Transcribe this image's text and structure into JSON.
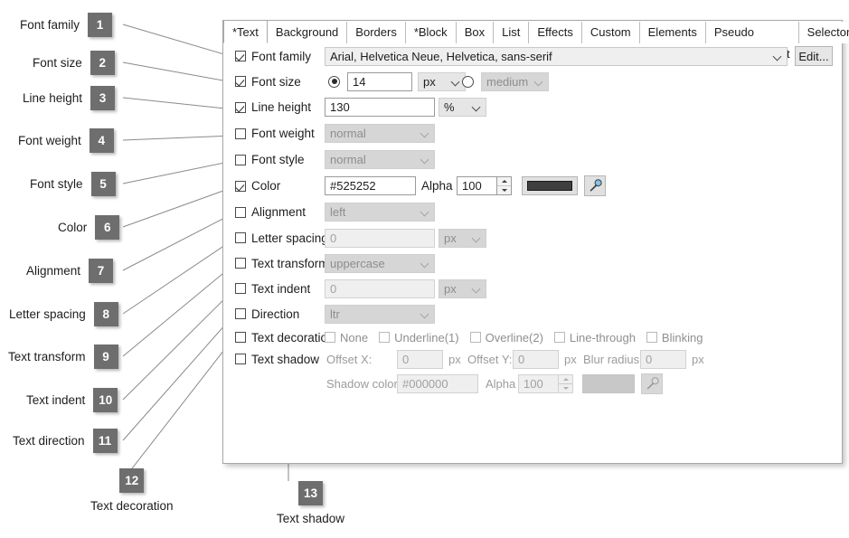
{
  "annotations": {
    "items": [
      {
        "num": "1",
        "label": "Font family"
      },
      {
        "num": "2",
        "label": "Font size"
      },
      {
        "num": "3",
        "label": "Line height"
      },
      {
        "num": "4",
        "label": "Font weight"
      },
      {
        "num": "5",
        "label": "Font style"
      },
      {
        "num": "6",
        "label": "Color"
      },
      {
        "num": "7",
        "label": "Alignment"
      },
      {
        "num": "8",
        "label": "Letter spacing"
      },
      {
        "num": "9",
        "label": "Text transform"
      },
      {
        "num": "10",
        "label": "Text indent"
      },
      {
        "num": "11",
        "label": "Text direction"
      },
      {
        "num": "12",
        "label": "Text decoration"
      },
      {
        "num": "13",
        "label": "Text shadow"
      }
    ]
  },
  "dialog": {
    "tabs": [
      {
        "label": "*Text",
        "active": true
      },
      {
        "label": "Background",
        "active": false
      },
      {
        "label": "Borders",
        "active": false
      },
      {
        "label": "*Block",
        "active": false
      },
      {
        "label": "Box",
        "active": false
      },
      {
        "label": "List",
        "active": false
      },
      {
        "label": "Effects",
        "active": false
      },
      {
        "label": "Custom",
        "active": false
      },
      {
        "label": "Elements",
        "active": false
      },
      {
        "label": "Pseudo Class/Element",
        "active": false
      },
      {
        "label": "Selectors",
        "active": false
      }
    ],
    "rows": {
      "font_family": {
        "label": "Font family",
        "checked": true,
        "value": "Arial, Helvetica Neue, Helvetica, sans-serif",
        "edit_button": "Edit..."
      },
      "font_size": {
        "label": "Font size",
        "checked": true,
        "value": "14",
        "unit": "px",
        "keyword": "medium",
        "radio_numeric_selected": true
      },
      "line_height": {
        "label": "Line height",
        "checked": true,
        "value": "130",
        "unit": "%"
      },
      "font_weight": {
        "label": "Font weight",
        "checked": false,
        "value": "normal"
      },
      "font_style": {
        "label": "Font style",
        "checked": false,
        "value": "normal"
      },
      "color": {
        "label": "Color",
        "checked": true,
        "value": "#525252",
        "alpha_label": "Alpha",
        "alpha": "100",
        "swatch": "#3f3f3f",
        "eyedropper_icon": "eyedropper-icon"
      },
      "alignment": {
        "label": "Alignment",
        "checked": false,
        "value": "left"
      },
      "letter_spacing": {
        "label": "Letter spacing",
        "checked": false,
        "value": "0",
        "unit": "px"
      },
      "text_transform": {
        "label": "Text transform",
        "checked": false,
        "value": "uppercase"
      },
      "text_indent": {
        "label": "Text indent",
        "checked": false,
        "value": "0",
        "unit": "px"
      },
      "direction": {
        "label": "Direction",
        "checked": false,
        "value": "ltr"
      },
      "text_decoration": {
        "label": "Text decoration",
        "checked": false,
        "options": [
          {
            "label": "None",
            "checked": false
          },
          {
            "label": "Underline(1)",
            "checked": false
          },
          {
            "label": "Overline(2)",
            "checked": false
          },
          {
            "label": "Line-through",
            "checked": false
          },
          {
            "label": "Blinking",
            "checked": false
          }
        ]
      },
      "text_shadow": {
        "label": "Text shadow",
        "checked": false,
        "offset_x_label": "Offset X:",
        "offset_x": "0",
        "offset_x_unit": "px",
        "offset_y_label": "Offset Y:",
        "offset_y": "0",
        "offset_y_unit": "px",
        "blur_label": "Blur radius:",
        "blur": "0",
        "blur_unit": "px",
        "shadow_color_label": "Shadow color:",
        "shadow_color": "#000000",
        "alpha_label": "Alpha",
        "alpha": "100",
        "swatch": "#c8c8c8",
        "eyedropper_icon": "eyedropper-icon"
      }
    }
  },
  "colors": {
    "badge_bg": "#6e6e6e",
    "leader_line": "#8a8a8a",
    "dialog_border": "#a8a8a8",
    "text": "#1d1d1d",
    "disabled_text": "#9b9b9b"
  }
}
